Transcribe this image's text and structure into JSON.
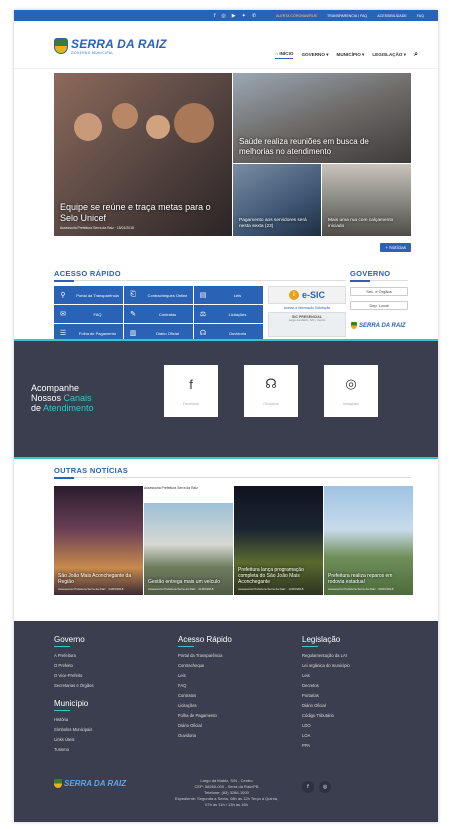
{
  "topbar": {
    "social_icons": [
      "facebook-icon",
      "instagram-icon",
      "youtube-icon",
      "twitter-icon",
      "whatsapp-icon"
    ],
    "links": [
      "ALERTA CORONAVIRUS",
      "TRANSPARENCIA / FAQ",
      "ACESSIBILIDADE",
      "FAQ"
    ]
  },
  "header": {
    "logo_name": "SERRA DA RAIZ",
    "logo_sub": "GOVERNO MUNICIPAL",
    "nav": [
      "INÍCIO",
      "GOVERNO",
      "MUNICÍPIO",
      "LEGISLAÇÃO"
    ]
  },
  "hero": {
    "main": {
      "title": "Equipe se reúne e traça metas para o Selo Unicef",
      "meta": "Assessoria Prefeitura Serra da Raiz · 15/01/2018"
    },
    "top_right": {
      "title": "Saúde realiza reuniões em busca de melhorias no atendimento"
    },
    "bottom_left": {
      "title": "Pagamento aos servidores será nesta sexta (23)"
    },
    "bottom_right": {
      "title": "Mais uma rua com calçamento iniciado"
    },
    "more_label": "+ Notícias"
  },
  "quick_access": {
    "title": "ACESSO RÁPIDO",
    "items": [
      {
        "icon": "transparency-icon",
        "label": "Portal da Transparência"
      },
      {
        "icon": "ticket-icon",
        "label": "Contracheques Online"
      },
      {
        "icon": "doc-icon",
        "label": "Leis"
      },
      {
        "icon": "faq-icon",
        "label": "FAQ"
      },
      {
        "icon": "contract-icon",
        "label": "Contratos"
      },
      {
        "icon": "gavel-icon",
        "label": "Licitações"
      },
      {
        "icon": "payroll-icon",
        "label": "Folha de Pagamento"
      },
      {
        "icon": "book-icon",
        "label": "Diário Oficial"
      },
      {
        "icon": "headset-icon",
        "label": "Ouvidoria"
      }
    ],
    "esic": {
      "name": "e-SIC",
      "caption": "Acesso à Informação Solicitação",
      "heading": "SIC PRESENCIAL",
      "details": "Largo da Matriz, S/N - Centro"
    }
  },
  "governo": {
    "title": "GOVERNO",
    "buttons": [
      "Sec. e Órgãos",
      "Dep. Local"
    ],
    "logo_name": "SERRA DA RAIZ"
  },
  "channels": {
    "heading_1": "Acompanhe",
    "heading_2a": "Nossos",
    "heading_2b": "Canais",
    "heading_3a": "de",
    "heading_3b": "Atendimento",
    "items": [
      {
        "glyph": "f",
        "label": "Facebook"
      },
      {
        "glyph": "☊",
        "label": "Ouvidoria"
      },
      {
        "glyph": "◎",
        "label": "Instagram"
      }
    ]
  },
  "other_news": {
    "title": "OUTRAS NOTÍCIAS",
    "items": [
      {
        "title": "São João Mais Aconchegante da Região",
        "meta": "Assessoria Prefeitura Serra da Raiz · 24/06/2018"
      },
      {
        "header": "Assessoria Prefeitura Serra da Raiz",
        "title": "Gestão entrega mais um veículo",
        "meta": "Assessoria Prefeitura Serra da Raiz · 21/06/2018"
      },
      {
        "title": "Prefeitura lança programação completa do São João Mais Aconchegante",
        "meta": "Assessoria Prefeitura Serra da Raiz · 13/06/2018"
      },
      {
        "title": "Prefeitura realiza reparos em rodovia estadual",
        "meta": "Assessoria Prefeitura Serra da Raiz · 08/06/2018"
      }
    ]
  },
  "footer": {
    "governo": {
      "title": "Governo",
      "items": [
        "A Prefeitura",
        "O Prefeito",
        "O Vice-Prefeito",
        "Secretarias e Órgãos"
      ]
    },
    "municipio": {
      "title": "Município",
      "items": [
        "História",
        "Símbolos Municipais",
        "Links Úteis",
        "Turismo"
      ]
    },
    "acesso": {
      "title": "Acesso Rápido",
      "items": [
        "Portal da Transparência",
        "Contracheque",
        "Leis",
        "FAQ",
        "Contratos",
        "Licitações",
        "Folha de Pagamento",
        "Diário Oficial",
        "Ouvidoria"
      ]
    },
    "legislacao": {
      "title": "Legislação",
      "items": [
        "Regulamentação da LAI",
        "Lei orgânica do município",
        "Leis",
        "Decretos",
        "Portarias",
        "Diário Oficial",
        "Código Tributário",
        "LDO",
        "LOA",
        "PPA"
      ]
    },
    "logo_name": "SERRA DA RAIZ",
    "address": [
      "Largo da Matriz, S/N - Centro",
      "CEP: 58260-000 - Serra da Raiz/PB",
      "Telefone: (83) 3286-1000",
      "Expediente: Segunda a Sexta, 08h às 12h Terça à Quinta,",
      "07h às 11h / 13h às 16h"
    ],
    "social": [
      "f",
      "◎"
    ]
  }
}
